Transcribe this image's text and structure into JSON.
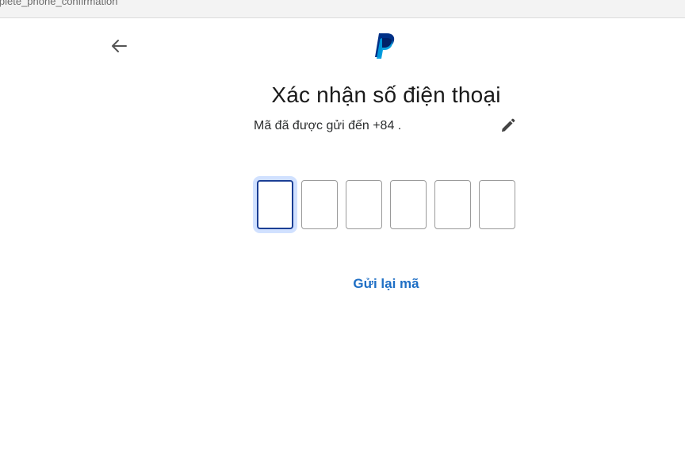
{
  "browser": {
    "url_fragment": "iplete_phone_confirmation"
  },
  "icons": {
    "back": "arrow-left-icon",
    "logo": "paypal-logo",
    "edit": "pencil-icon"
  },
  "main": {
    "title": "Xác nhận số điện thoại",
    "sent_to_text": "Mã đã được gửi đến +84 .",
    "code_inputs": [
      {
        "value": ""
      },
      {
        "value": ""
      },
      {
        "value": ""
      },
      {
        "value": ""
      },
      {
        "value": ""
      },
      {
        "value": ""
      }
    ],
    "resend_label": "Gửi lại mã"
  },
  "colors": {
    "paypal_dark_blue": "#003087",
    "paypal_light_blue": "#009cde",
    "focus_border": "#1b3f95",
    "link_blue": "#1f6fc5"
  }
}
